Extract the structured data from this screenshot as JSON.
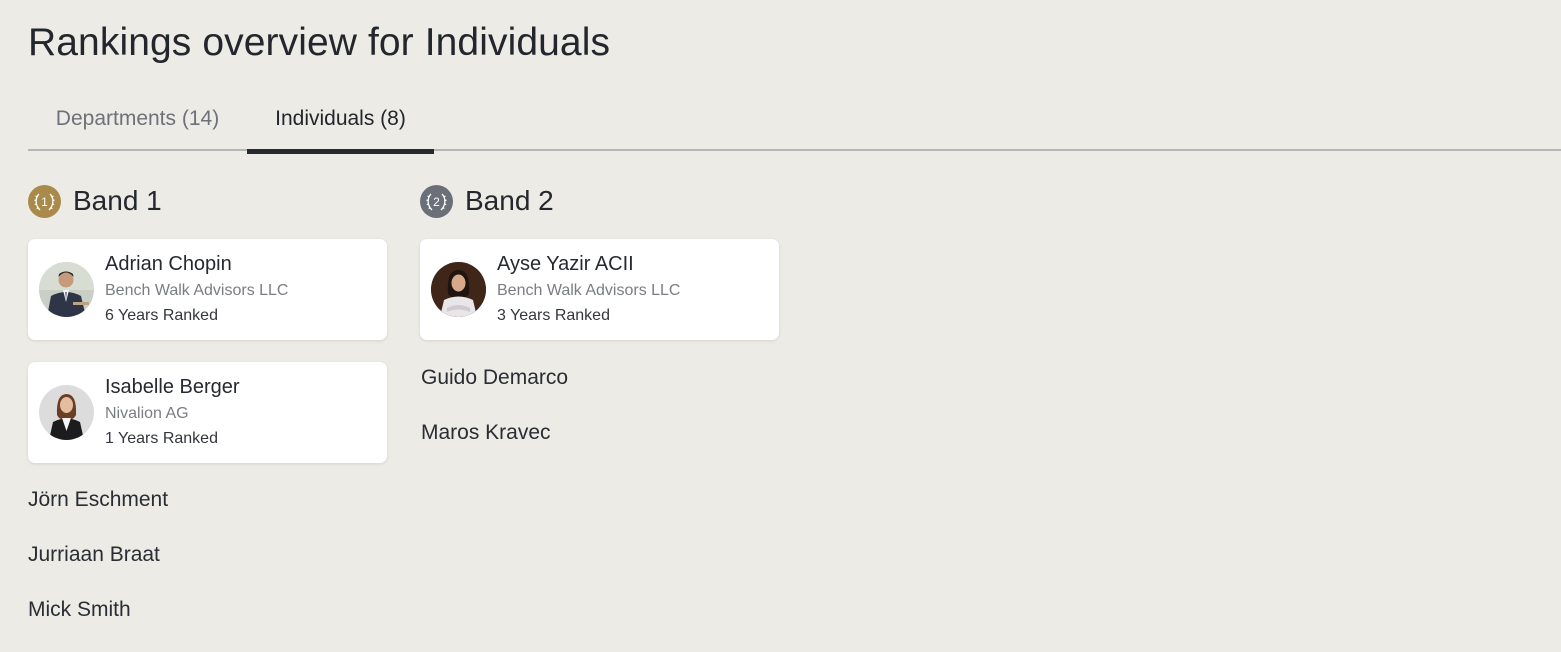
{
  "page": {
    "title": "Rankings overview for Individuals"
  },
  "tabs": [
    {
      "label": "Departments (14)",
      "active": false
    },
    {
      "label": "Individuals (8)",
      "active": true
    }
  ],
  "colors": {
    "background": "#ecebe6",
    "band1_medal": "#a98a4b",
    "band2_medal": "#6b6f78",
    "active_tab_underline": "#262930"
  },
  "bands": [
    {
      "title": "Band 1",
      "medal_number": "1",
      "medal_icon": "laurel-medal-gold-icon",
      "cards": [
        {
          "name": "Adrian Chopin",
          "firm": "Bench Walk Advisors LLC",
          "years": "6 Years Ranked",
          "avatar": "man-in-suit-photo"
        },
        {
          "name": "Isabelle Berger",
          "firm": "Nivalion AG",
          "years": "1 Years Ranked",
          "avatar": "woman-in-black-blazer-photo"
        }
      ],
      "names": [
        "Jörn Eschment",
        "Jurriaan Braat",
        "Mick Smith"
      ]
    },
    {
      "title": "Band 2",
      "medal_number": "2",
      "medal_icon": "laurel-medal-silver-icon",
      "cards": [
        {
          "name": "Ayse Yazir ACII",
          "firm": "Bench Walk Advisors LLC",
          "years": "3 Years Ranked",
          "avatar": "woman-dark-hair-photo"
        }
      ],
      "names": [
        "Guido Demarco",
        "Maros Kravec"
      ]
    }
  ]
}
